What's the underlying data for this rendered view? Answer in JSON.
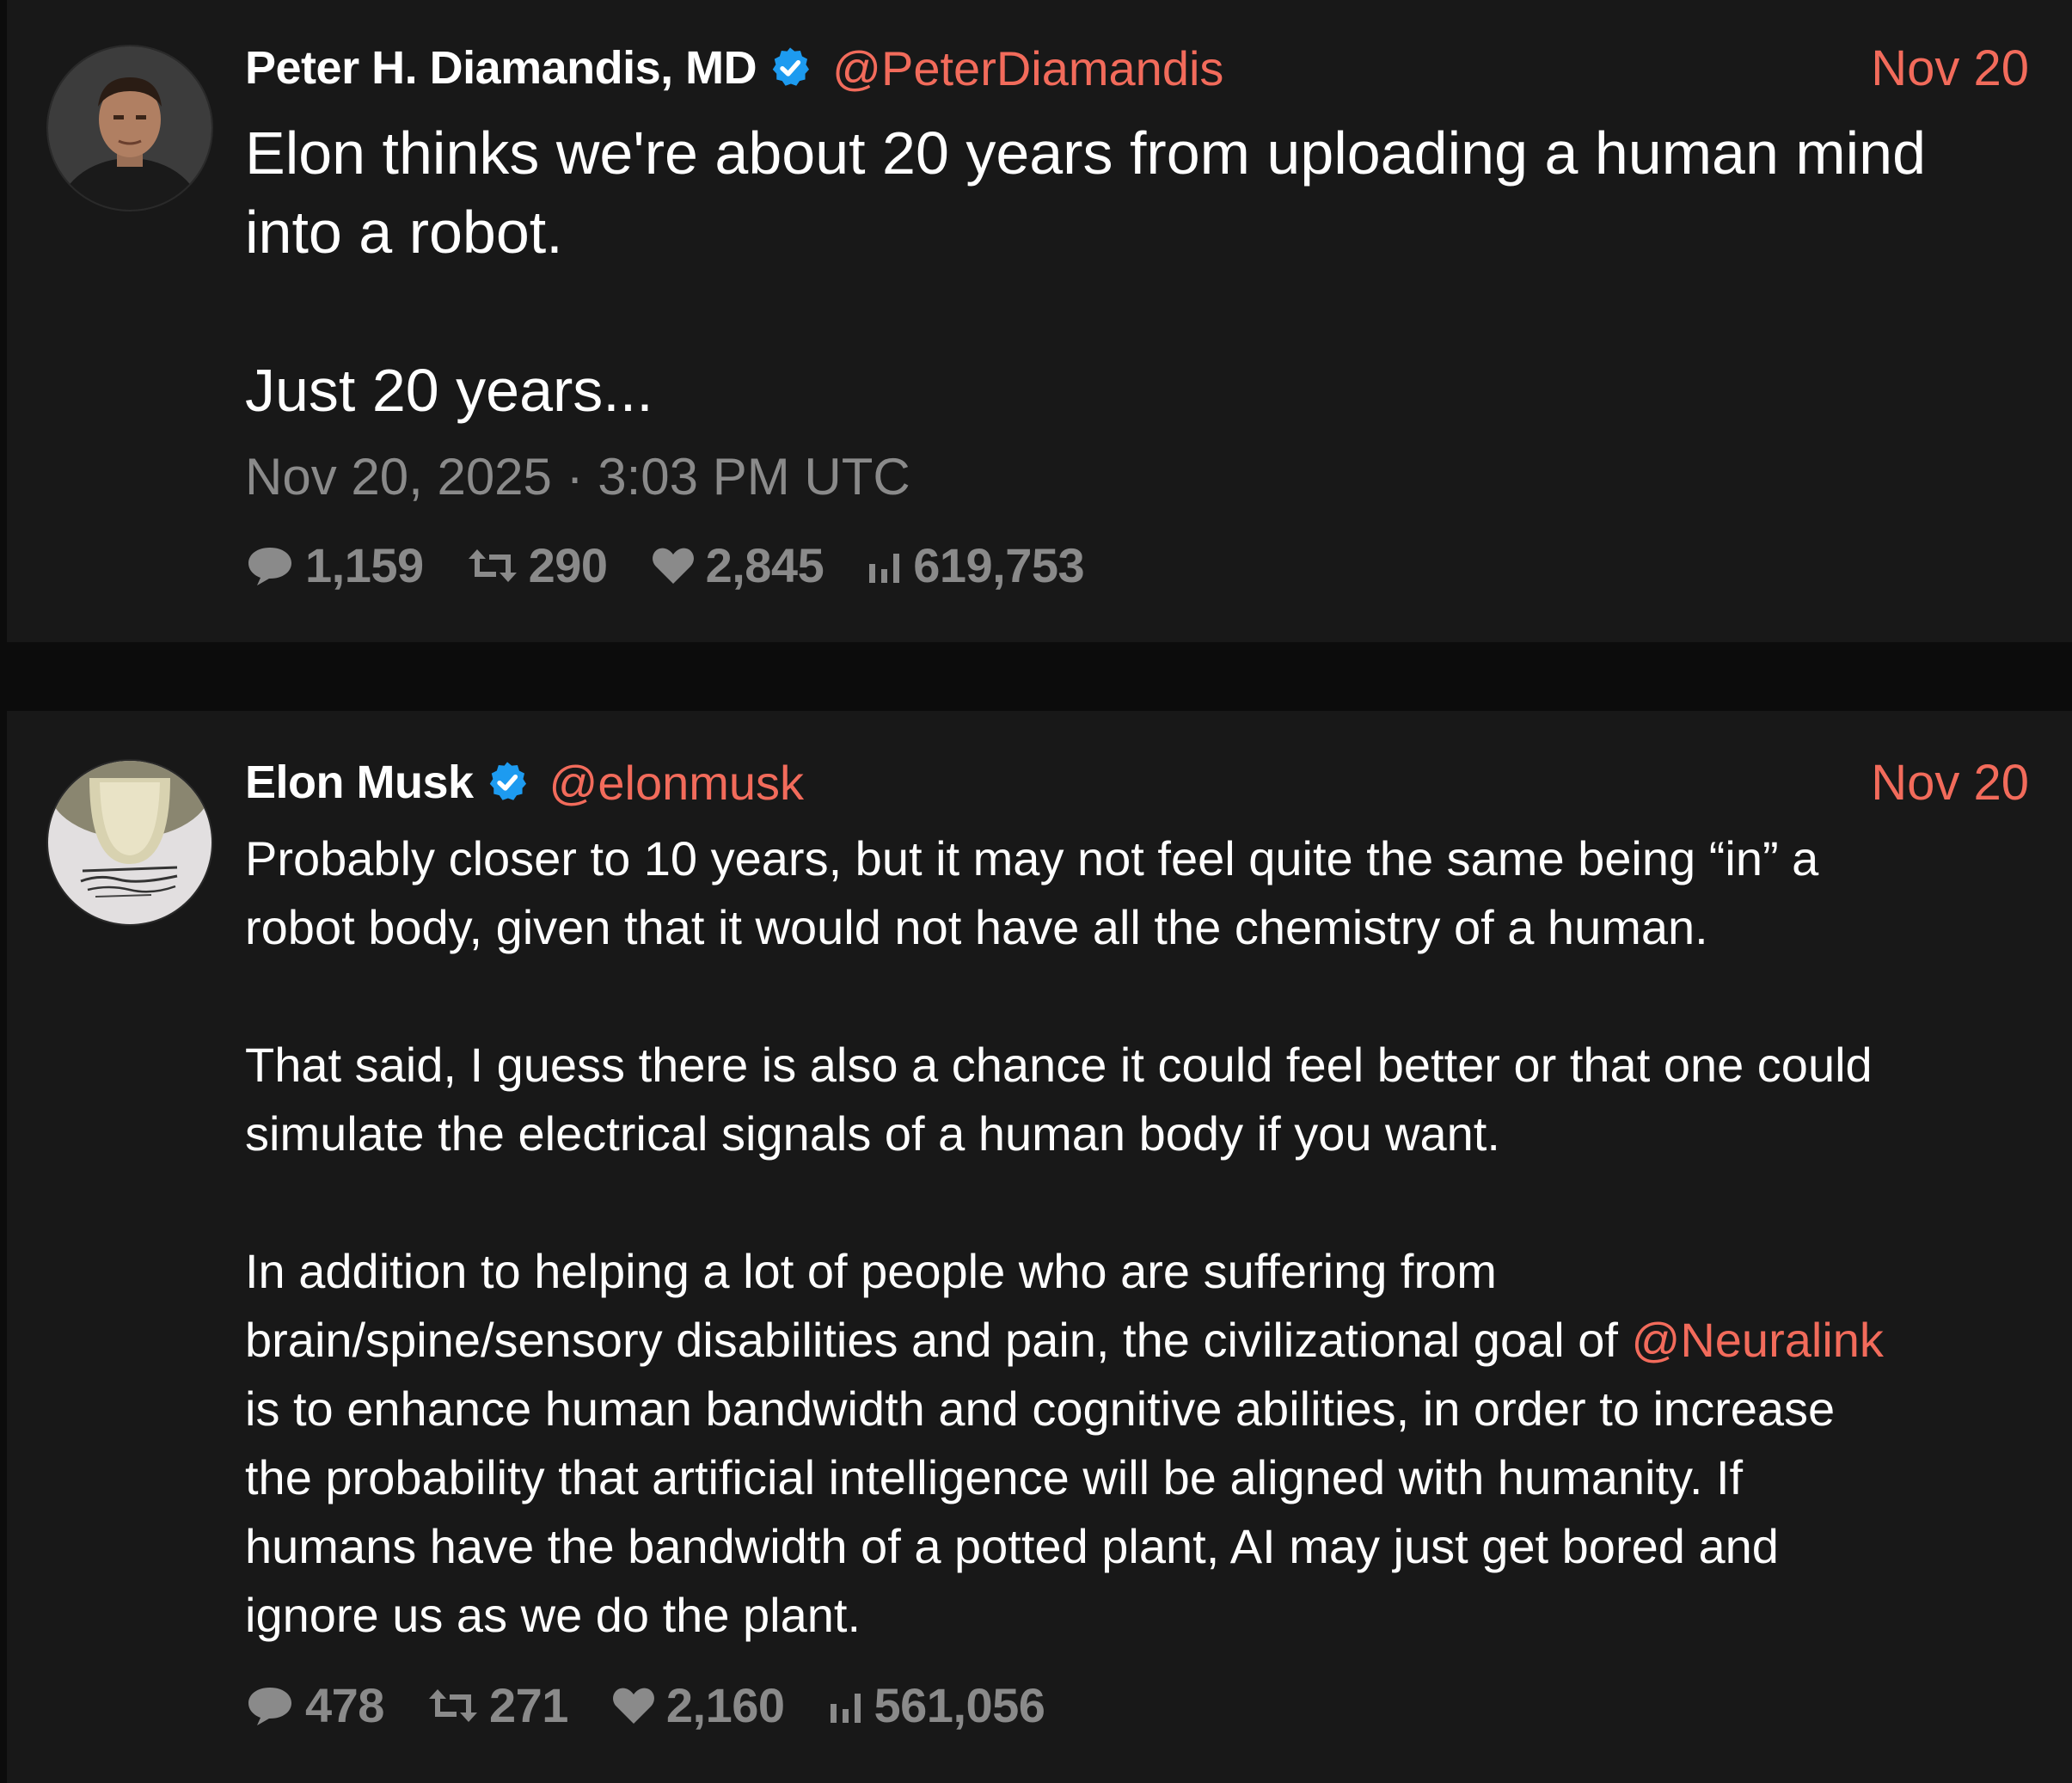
{
  "tweets": [
    {
      "author": "Peter H. Diamandis, MD",
      "handle": "@PeterDiamandis",
      "date_short": "Nov 20",
      "text": "Elon thinks we're about 20 years from uploading a human mind\ninto a robot.\n\nJust 20 years...",
      "timestamp": "Nov 20, 2025 · 3:03 PM UTC",
      "stats": {
        "replies": "1,159",
        "retweets": "290",
        "likes": "2,845",
        "views": "619,753"
      }
    },
    {
      "author": "Elon Musk",
      "handle": "@elonmusk",
      "date_short": "Nov 20",
      "text_part1": "Probably closer to 10 years, but it may not feel quite the same being “in” a\nrobot body, given that it would not have all the chemistry of a human.\n\nThat said, I guess there is also a chance it could feel better or that one could\nsimulate the electrical signals of a human body if you want.\n\nIn addition to helping a lot of people who are suffering from\nbrain/spine/sensory disabilities and pain, the civilizational goal of ",
      "mention": "@Neuralink",
      "text_part2": "\nis to enhance human bandwidth and cognitive abilities, in order to increase\nthe probability that artificial intelligence will be aligned with humanity. If\nhumans have the bandwidth of a potted plant, AI may just get bored and\nignore us as we do the plant.",
      "stats": {
        "replies": "478",
        "retweets": "271",
        "likes": "2,160",
        "views": "561,056"
      }
    }
  ],
  "colors": {
    "background": "#0c0c0c",
    "card": "#181818",
    "accent": "#f26b5b",
    "muted": "#8a8a8a",
    "verified": "#1d9bf0"
  },
  "icons": [
    "verified-badge-icon",
    "reply-icon",
    "retweet-icon",
    "like-icon",
    "views-icon"
  ]
}
